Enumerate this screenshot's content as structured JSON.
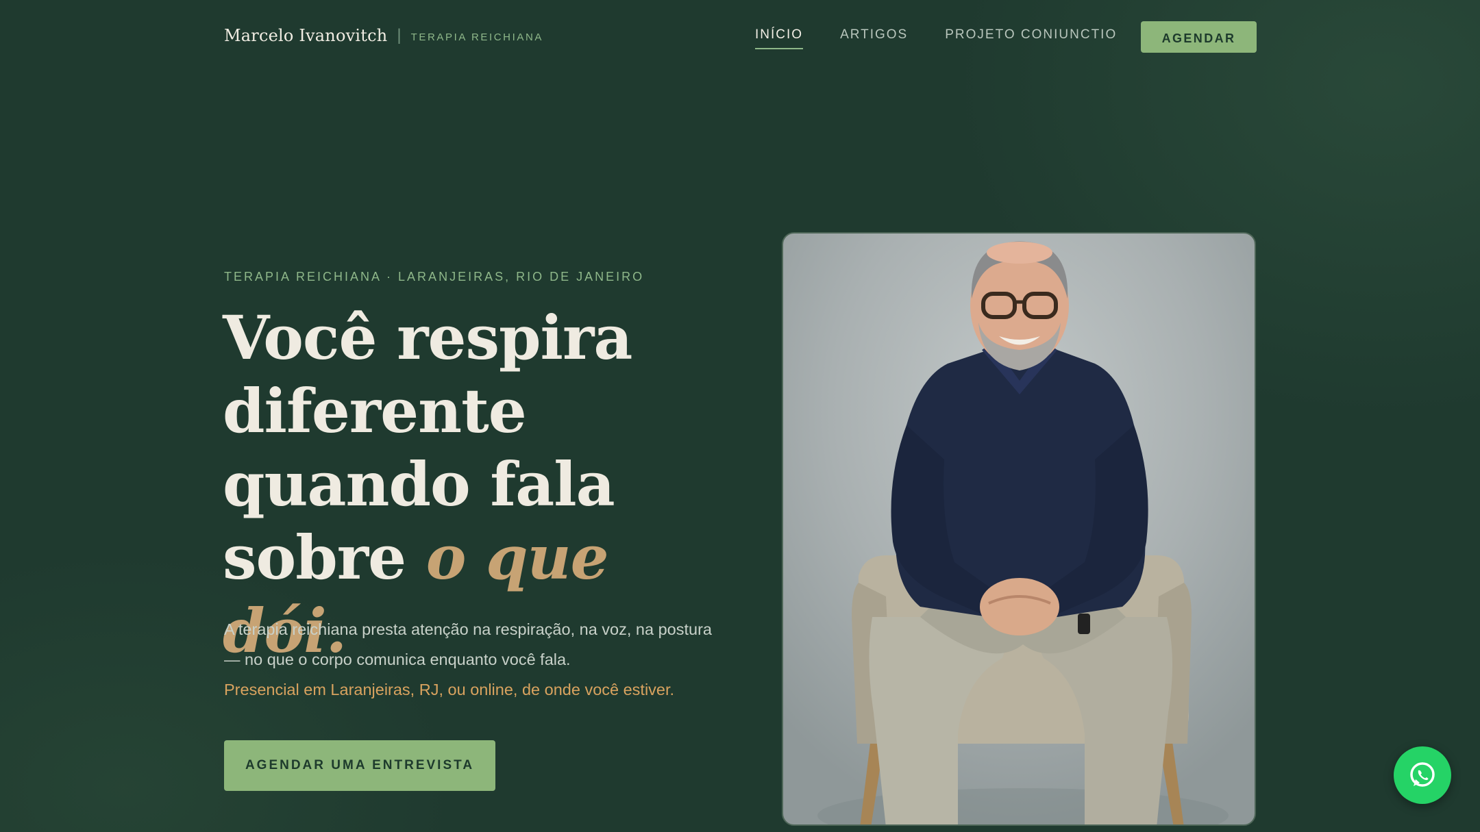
{
  "header": {
    "brand_name": "Marcelo Ivanovitch",
    "brand_separator": "|",
    "brand_tagline": "TERAPIA REICHIANA",
    "nav": [
      {
        "label": "INÍCIO",
        "active": true
      },
      {
        "label": "ARTIGOS",
        "active": false
      },
      {
        "label": "PROJETO CONIUNCTIO",
        "active": false
      }
    ],
    "cta_label": "AGENDAR"
  },
  "hero": {
    "eyebrow": "TERAPIA REICHIANA · LARANJEIRAS, RIO DE JANEIRO",
    "headline_lines": [
      "Você respira",
      "diferente",
      "quando fala",
      "sobre "
    ],
    "headline_accent": "o que dói.",
    "lead": "A terapia reichiana presta atenção na respiração, na voz, na postura — no que o corpo comunica enquanto você fala.",
    "lead_accent": "Presencial em Laranjeiras, RJ, ou online, de onde você estiver.",
    "cta_label": "AGENDAR UMA ENTREVISTA"
  },
  "colors": {
    "background": "#1f3a2f",
    "accent_green": "#8db67a",
    "accent_gold": "#c7a374",
    "whatsapp": "#25d366"
  },
  "icons": {
    "floating_button": "whatsapp-icon"
  }
}
